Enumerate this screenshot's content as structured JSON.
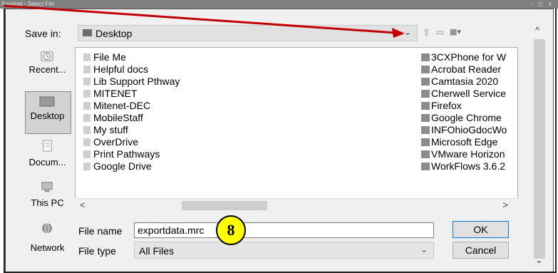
{
  "window": {
    "title": "Sgadget - Select File",
    "controls": "- ◻ x"
  },
  "save_in": {
    "label": "Save in:",
    "value": "Desktop",
    "chevron": "⌄"
  },
  "toolbar": {
    "up_icon": "⇧",
    "new_folder_icon": "▭",
    "views_icon": "▦▾"
  },
  "places": [
    {
      "label": "Recent...",
      "icon": "recent-icon"
    },
    {
      "label": "Desktop",
      "icon": "desktop-icon",
      "selected": true
    },
    {
      "label": "Docum...",
      "icon": "documents-icon"
    },
    {
      "label": "This PC",
      "icon": "this-pc-icon"
    },
    {
      "label": "Network",
      "icon": "network-icon"
    }
  ],
  "files_left": [
    "File Me",
    "Helpful docs",
    "Lib Support Pthway",
    "MITENET",
    "Mitenet-DEC",
    "MobileStaff",
    "My stuff",
    "OverDrive",
    "Print Pathways",
    "Google Drive"
  ],
  "files_right": [
    "3CXPhone for W",
    "Acrobat Reader",
    "Camtasia 2020",
    "Cherwell Service",
    "Firefox",
    "Google Chrome",
    "INFOhioGdocWo",
    "Microsoft Edge",
    "VMware Horizon",
    "WorkFlows 3.6.2"
  ],
  "scroll": {
    "left": "<",
    "right": ">",
    "up": "^",
    "down": "⌄"
  },
  "file_name": {
    "label": "File name",
    "value": "exportdata.mrc"
  },
  "file_type": {
    "label": "File type",
    "value": "All Files",
    "chevron": "⌄"
  },
  "buttons": {
    "ok": "OK",
    "cancel": "Cancel"
  },
  "callout": {
    "number": "8",
    "color": "#ffff00"
  },
  "colors": {
    "arrow": "#c00000",
    "dialog_bg": "#f0f0f0",
    "ok_border": "#0078d7"
  }
}
